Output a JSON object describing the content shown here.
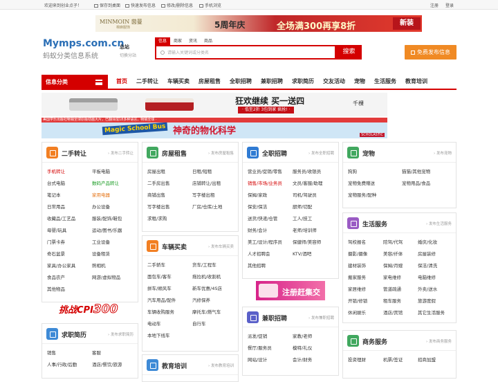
{
  "topbar": {
    "welcome": "欢迎来到创业点子！",
    "links": [
      "保存到桌面",
      "快速发布信息",
      "修改/删除信息",
      "手机浏览"
    ],
    "account": [
      "注册",
      "登录"
    ]
  },
  "banner": {
    "brand": "MINMOIN 茵曼",
    "brand_sub": "棉麻服饰",
    "anniv": "5周年庆",
    "promo": "全场满300再享8折",
    "tag": "新装"
  },
  "logo": {
    "domain": "Mymps.com.cn",
    "name": "蚂蚁分类信息系统"
  },
  "station": {
    "label": "总站",
    "switch": "切换分站"
  },
  "search": {
    "tabs": [
      "信息",
      "商家",
      "资讯",
      "商品"
    ],
    "active_tab": 0,
    "placeholder": "请输入关键词或分类名",
    "button": "搜索"
  },
  "post_button": "免费发布信息",
  "nav": {
    "category_button": "信息分类",
    "links": [
      "首页",
      "二手转让",
      "车辆买卖",
      "房屋租售",
      "全职招聘",
      "兼职招聘",
      "求职简历",
      "交友活动",
      "宠物",
      "生活服务",
      "教育培训"
    ],
    "active": 0
  },
  "ads": {
    "ad1_title": "狂欢继续 买一送四",
    "ad1_sub": "· 低至2折 3包到家 疯抢! ·",
    "ad1_brand": "千棵",
    "ad2_strip": "美国学乐出版社畅销全球原版动画大片，已翻译成18多种语言，畅销全球 ·",
    "ad2_title": "Magic School Bus",
    "ad2_cn": "神奇的物化科学",
    "ad2_pub": "SCHOLASTIC",
    "cpi": "挑战CPI",
    "cpi_num": "300",
    "reg": "注册赶集交"
  },
  "sections": {
    "ershou": {
      "title": "二手转让",
      "post": "› 发布二手转让",
      "color": "#f27f22",
      "rows": [
        [
          "手机转让",
          "平板电脑"
        ],
        [
          "台式电脑",
          "数码产品转让"
        ],
        [
          "笔记本",
          "家用电器"
        ],
        [
          "日常用品",
          "办公设备"
        ],
        [
          "收藏品/工艺品",
          "服装/配饰/鞋包"
        ],
        [
          "母婴/玩具",
          "运动/图书/乐器"
        ],
        [
          "门票卡券",
          "工业设备"
        ],
        [
          "奇石盆景",
          "设备租赁"
        ],
        [
          "家具/办公家具",
          "照相机"
        ],
        [
          "食品农产",
          "网游/虚拟物品"
        ],
        [
          "其他物品",
          ""
        ]
      ]
    },
    "fangwu": {
      "title": "房屋租售",
      "post": "› 发布房屋租售",
      "color": "#41a85f",
      "rows": [
        [
          "房屋出租",
          "日租/短租"
        ],
        [
          "二手房出售",
          "店铺转让/出租"
        ],
        [
          "商铺出售",
          "写字楼出租"
        ],
        [
          "写字楼出售",
          "厂房/仓库/土地"
        ],
        [
          "求租/求购",
          ""
        ]
      ]
    },
    "cheliang": {
      "title": "车辆买卖",
      "post": "› 发布车辆买卖",
      "color": "#f27f22",
      "rows": [
        [
          "二手轿车",
          "货车/工程车"
        ],
        [
          "面包车/客车",
          "拖拉机/收割机"
        ],
        [
          "拼车/顺风车",
          "新车优惠/4S店"
        ],
        [
          "汽车用品/配件",
          "汽修保养"
        ],
        [
          "车辆收购服务",
          "摩托车/燃气车"
        ],
        [
          "电动车",
          "自行车"
        ],
        [
          "本地下线车",
          ""
        ]
      ]
    },
    "jiaoyu": {
      "title": "教育培训",
      "post": "› 发布教育培训",
      "color": "#3e8ad6"
    },
    "quanzhi": {
      "title": "全职招聘",
      "post": "› 发布全职招聘",
      "color": "#2f7bd3",
      "rows": [
        [
          "营业员/促销/零售",
          "服务员/收银员"
        ],
        [
          "销售/市场/业务员",
          "文员/客服/助理"
        ],
        [
          "保姆/家政",
          "司机/驾驶员"
        ],
        [
          "保安/保洁",
          "厨师/切配"
        ],
        [
          "送货/快递/仓管",
          "工人/技工"
        ],
        [
          "财务/会计",
          "老师/培训师"
        ],
        [
          "美工/设计/程序员",
          "保健师/美容师"
        ],
        [
          "人才招聘会",
          "KTV/酒吧"
        ],
        [
          "其他招聘",
          ""
        ]
      ]
    },
    "jianzhi": {
      "title": "兼职招聘",
      "post": "› 发布兼职招聘",
      "color": "#5a60c9",
      "rows": [
        [
          "派发/促销",
          "家教/老师"
        ],
        [
          "餐厅/服务员",
          "模特/礼仪"
        ],
        [
          "网站/设计",
          "会计/财务"
        ]
      ]
    },
    "qiuzhi": {
      "title": "求职简历",
      "post": "› 发布求职简历",
      "color": "#3e8ad6",
      "rows": [
        [
          "销售",
          "客服"
        ],
        [
          "人事/行政/后勤",
          "酒店/餐饮/旅游"
        ]
      ]
    },
    "chongwu": {
      "title": "宠物",
      "post": "› 发布宠物",
      "color": "#41a85f",
      "rows": [
        [
          "狗狗",
          "猫猫/其他宠物"
        ],
        [
          "宠物免费赠送",
          "宠物用品/食品"
        ],
        [
          "宠物服务/配种",
          ""
        ]
      ]
    },
    "shenghuo": {
      "title": "生活服务",
      "post": "› 发布生活服务",
      "color": "#9a5bc4",
      "rows": [
        [
          "驾校报名",
          "陪驾/代驾",
          "婚庆/化妆"
        ],
        [
          "摄影/摄像",
          "美容/纤体",
          "房屋装修"
        ],
        [
          "建材装饰",
          "保姆/月嫂",
          "保洁/清洗"
        ],
        [
          "搬家服务",
          "家电维修",
          "电脑维修"
        ],
        [
          "家居维修",
          "管道疏通",
          "外卖/送水"
        ],
        [
          "开锁/修锁",
          "租车服务",
          "旅游度假"
        ],
        [
          "休闲娱乐",
          "酒店/宾馆",
          "其它生活服务"
        ]
      ]
    },
    "shangwu": {
      "title": "商务服务",
      "post": "› 发布商务服务",
      "color": "#41a85f",
      "rows": [
        [
          "投资理财",
          "机票/签证",
          "招商加盟"
        ]
      ]
    }
  },
  "highlight_colors": {
    "red": "#d40000",
    "green": "#159a1f",
    "orange": "#e57416"
  }
}
